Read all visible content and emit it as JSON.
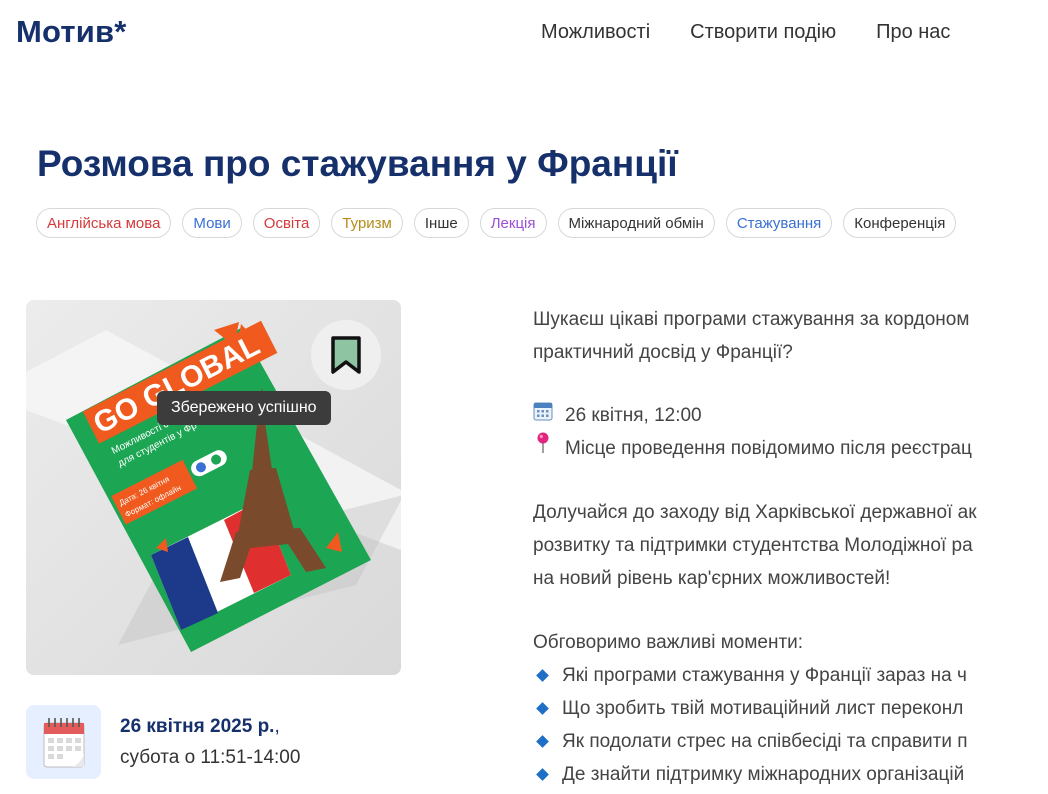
{
  "header": {
    "logo": "Мотив*",
    "nav": [
      "Можливості",
      "Створити подію",
      "Про нас"
    ]
  },
  "event": {
    "title": "Розмова про стажування у Франції",
    "tags": [
      {
        "label": "Англійська мова",
        "color": "#d43a3a"
      },
      {
        "label": "Мови",
        "color": "#3a6fd4"
      },
      {
        "label": "Освіта",
        "color": "#d43a3a"
      },
      {
        "label": "Туризм",
        "color": "#b58b1a"
      },
      {
        "label": "Інше",
        "color": "#333333"
      },
      {
        "label": "Лекція",
        "color": "#9a4fd4"
      },
      {
        "label": "Міжнародний обмін",
        "color": "#333333"
      },
      {
        "label": "Стажування",
        "color": "#3a6fd4"
      },
      {
        "label": "Конференція",
        "color": "#333333"
      }
    ],
    "poster": {
      "headline": "GO GLOBAL",
      "subtitle_1": "Можливості ст",
      "subtitle_2": "для студентів у Фр",
      "date_line": "Дата: 26 квітня",
      "format_line": "Формат: офлайн"
    },
    "bookmark_icon": "bookmark-icon",
    "toast": "Збережено успішно",
    "date_bold": "26 квітня 2025 р.",
    "date_suffix": ",",
    "time_line": "субота о 11:51-14:00",
    "description": {
      "intro_1": "Шукаєш цікаві програми стажування за кордоном",
      "intro_2": "практичний досвід у Франції?",
      "date_info": "26 квітня, 12:00",
      "location_info": "Місце проведення повідомимо після реєстрац",
      "join_1": "Долучайся до заходу від Харківської державної ак",
      "join_2": "розвитку та підтримки студентства Молодіжної ра",
      "join_3": "на новий рівень кар'єрних можливостей!",
      "discuss": "Обговоримо важливі моменти:",
      "bullets": [
        "Які програми стажування у Франції зараз на ч",
        "Що зробить твій мотиваційний лист переконл",
        "Як подолати стрес на співбесіді та справити п",
        "Де знайти підтримку міжнародних організацій"
      ]
    }
  }
}
